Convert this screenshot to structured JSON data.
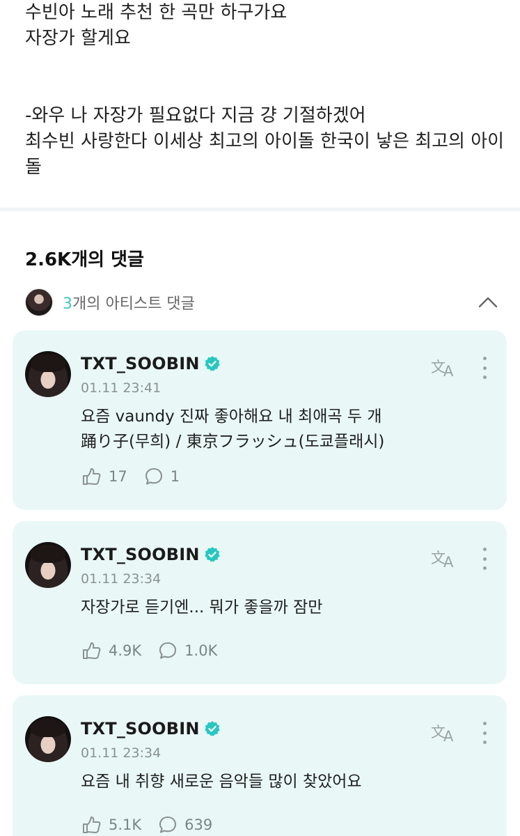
{
  "post": {
    "lines_para1": [
      "수빈아 노래 추천 한 곡만 하구가요",
      "자장가 할게요"
    ],
    "lines_para2": [
      "-와우 나 자장가 필요없다 지금 걍 기절하겠어",
      "최수빈 사랑한다 이세상 최고의 아이돌 한국이 낳은 최고의 아이",
      "돌"
    ]
  },
  "comments_header": {
    "count_label": "2.6K개의 댓글"
  },
  "artist_comments": {
    "count": "3",
    "label": "개의 아티스트 댓글"
  },
  "comments": [
    {
      "name": "TXT_SOOBIN",
      "time": "01.11 23:41",
      "text_lines": [
        "요즘 vaundy 진짜 좋아해요 내 최애곡 두 개",
        "踊り子(무희) / 東京フラッシュ(도쿄플래시)"
      ],
      "likes": "17",
      "replies": "1"
    },
    {
      "name": "TXT_SOOBIN",
      "time": "01.11 23:34",
      "text_lines": [
        "자장가로 듣기엔... 뭐가 좋을까 잠만"
      ],
      "likes": "4.9K",
      "replies": "1.0K"
    },
    {
      "name": "TXT_SOOBIN",
      "time": "01.11 23:34",
      "text_lines": [
        "요즘 내 취향 새로운 음악들 많이 찾았어요"
      ],
      "likes": "5.1K",
      "replies": "639"
    }
  ],
  "colors": {
    "card_bg": "#e9f8f6",
    "accent": "#3ec6c3",
    "verified": "#27c7c1"
  },
  "icons": [
    "translate-icon",
    "more-vertical-icon",
    "like-icon",
    "reply-icon",
    "verified-badge-icon",
    "chevron-up-icon"
  ]
}
